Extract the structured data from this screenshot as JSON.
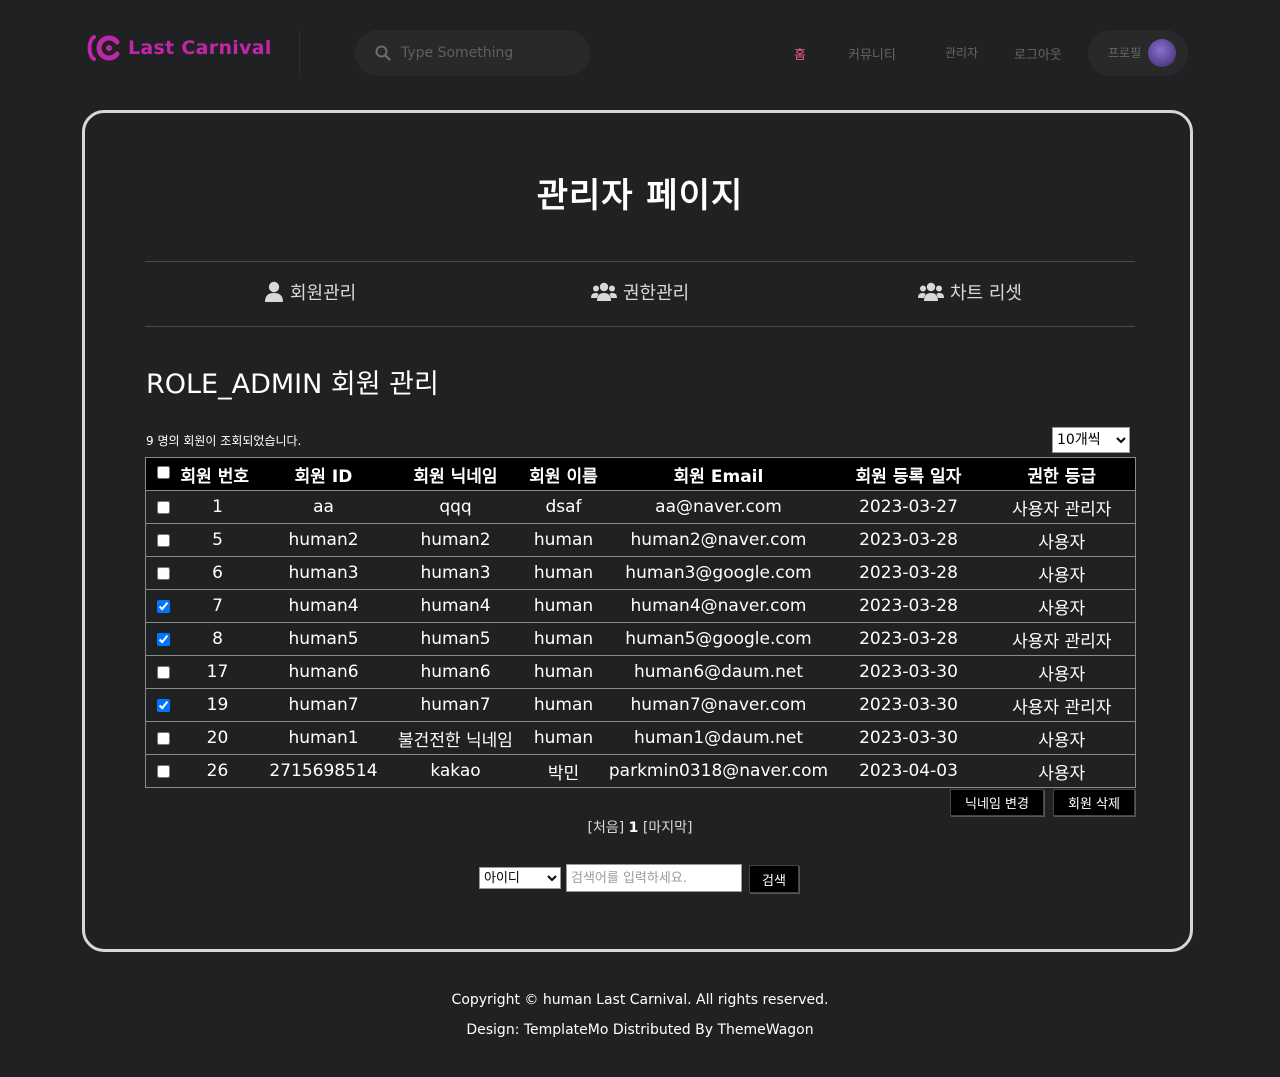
{
  "header": {
    "logo_text": "Last Carnival",
    "search_placeholder": "Type Something",
    "nav": [
      {
        "label": "홈"
      },
      {
        "label": "커뮤니티"
      },
      {
        "label": "관리자"
      },
      {
        "label": "로그아웃"
      }
    ],
    "profile_label": "프로필"
  },
  "page_title": "관리자 페이지",
  "tabs": [
    {
      "label": "회원관리",
      "icon": "user-icon"
    },
    {
      "label": "권한관리",
      "icon": "users-icon"
    },
    {
      "label": "차트 리셋",
      "icon": "users-icon"
    }
  ],
  "section_title": "ROLE_ADMIN 회원 관리",
  "result_count_text": "9 명의 회원이 조회되었습니다.",
  "per_page": {
    "selected": "10개씩"
  },
  "table": {
    "columns": [
      "회원 번호",
      "회원 ID",
      "회원 닉네임",
      "회원 이름",
      "회원 Email",
      "회원 등록 일자",
      "권한 등급"
    ],
    "rows": [
      {
        "checked": false,
        "no": "1",
        "id": "aa",
        "nickname": "qqq",
        "name": "dsaf",
        "email": "aa@naver.com",
        "date": "2023-03-27",
        "role": "사용자 관리자"
      },
      {
        "checked": false,
        "no": "5",
        "id": "human2",
        "nickname": "human2",
        "name": "human",
        "email": "human2@naver.com",
        "date": "2023-03-28",
        "role": "사용자"
      },
      {
        "checked": false,
        "no": "6",
        "id": "human3",
        "nickname": "human3",
        "name": "human",
        "email": "human3@google.com",
        "date": "2023-03-28",
        "role": "사용자"
      },
      {
        "checked": true,
        "no": "7",
        "id": "human4",
        "nickname": "human4",
        "name": "human",
        "email": "human4@naver.com",
        "date": "2023-03-28",
        "role": "사용자"
      },
      {
        "checked": true,
        "no": "8",
        "id": "human5",
        "nickname": "human5",
        "name": "human",
        "email": "human5@google.com",
        "date": "2023-03-28",
        "role": "사용자 관리자"
      },
      {
        "checked": false,
        "no": "17",
        "id": "human6",
        "nickname": "human6",
        "name": "human",
        "email": "human6@daum.net",
        "date": "2023-03-30",
        "role": "사용자"
      },
      {
        "checked": true,
        "no": "19",
        "id": "human7",
        "nickname": "human7",
        "name": "human",
        "email": "human7@naver.com",
        "date": "2023-03-30",
        "role": "사용자 관리자"
      },
      {
        "checked": false,
        "no": "20",
        "id": "human1",
        "nickname": "불건전한 닉네임",
        "name": "human",
        "email": "human1@daum.net",
        "date": "2023-03-30",
        "role": "사용자"
      },
      {
        "checked": false,
        "no": "26",
        "id": "2715698514",
        "nickname": "kakao",
        "name": "박민",
        "email": "parkmin0318@naver.com",
        "date": "2023-04-03",
        "role": "사용자"
      }
    ]
  },
  "buttons": {
    "change_nickname": "닉네임 변경",
    "delete_member": "회원 삭제",
    "search": "검색"
  },
  "pagination": {
    "first": "[처음]",
    "current": "1",
    "last": "[마지막]"
  },
  "search": {
    "type_selected": "아이디",
    "keyword_placeholder": "검색어를 입력하세요."
  },
  "footer": {
    "copyright": "Copyright © human Last Carnival. All rights reserved.",
    "design": "Design: TemplateMo Distributed By ThemeWagon"
  },
  "colors": {
    "background": "#1f2122",
    "brand": "#c026a8",
    "nav_active": "#e75e8d",
    "table_header": "#000000"
  }
}
